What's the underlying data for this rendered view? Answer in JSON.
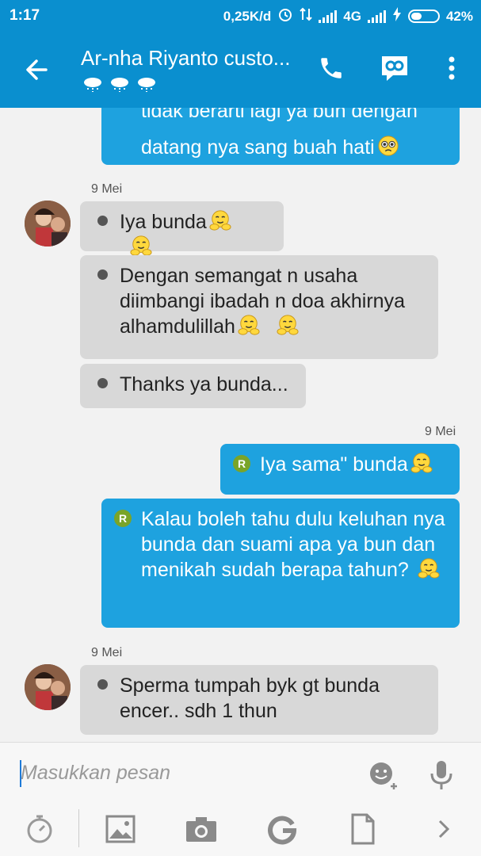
{
  "statusbar": {
    "time": "1:17",
    "speed": "0,25K/d",
    "network": "4G",
    "battery": "42%",
    "battery_level": 0.42
  },
  "header": {
    "title": "Ar-nha Riyanto custo...",
    "status_icons": [
      "cloud-rain-icon",
      "cloud-rain-icon",
      "cloud-rain-icon"
    ]
  },
  "messages": [
    {
      "dir": "out",
      "text_lines": [
        "tidak berarti lagi ya bun dengan",
        "datang nya sang buah hati"
      ]
    },
    {
      "date": "9 Mei"
    },
    {
      "dir": "in",
      "text": "Iya bunda"
    },
    {
      "dir": "in",
      "text": "Dengan semangat n usaha diimbangi ibadah n doa akhirnya alhamdulillah"
    },
    {
      "dir": "in",
      "text": "Thanks ya bunda..."
    },
    {
      "date": "9 Mei"
    },
    {
      "dir": "out",
      "badge": "R",
      "text": "Iya sama\" bunda"
    },
    {
      "dir": "out",
      "badge": "R",
      "text": "Kalau boleh tahu dulu keluhan nya bunda dan suami apa ya bun dan menikah sudah berapa tahun?"
    },
    {
      "date": "9 Mei"
    },
    {
      "dir": "in",
      "text": "Sperma tumpah byk gt bunda encer.. sdh 1 thun"
    }
  ],
  "input": {
    "placeholder": "Masukkan pesan"
  },
  "colors": {
    "primary": "#0a8fcf",
    "outgoing_bubble": "#1ea2df",
    "incoming_bubble": "#d8d8d8",
    "badge": "#7aa428"
  }
}
